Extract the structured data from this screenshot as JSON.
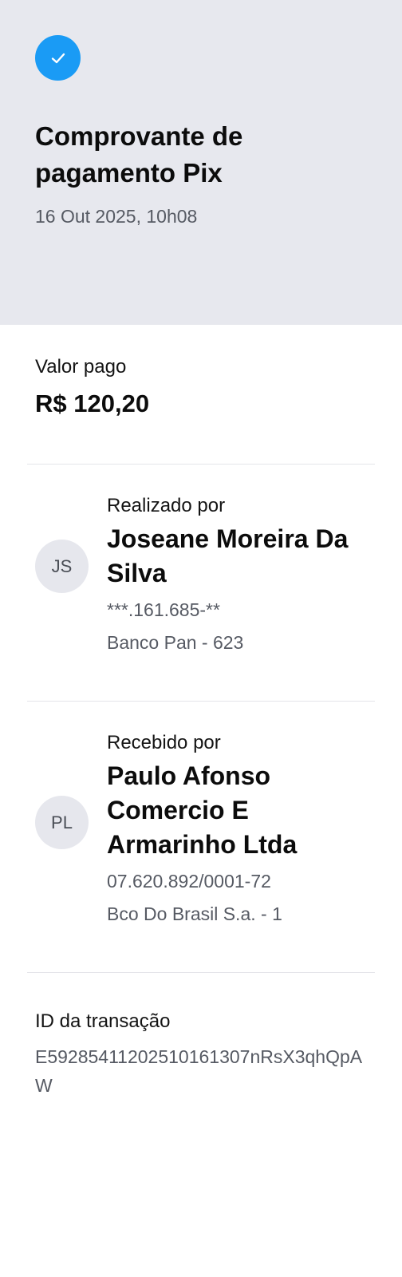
{
  "header": {
    "title": "Comprovante de pagamento Pix",
    "date": "16 Out 2025, 10h08",
    "icon": "check-icon",
    "accent_color": "#1a9bf5"
  },
  "amount": {
    "label": "Valor pago",
    "value": "R$ 120,20"
  },
  "payer": {
    "label": "Realizado por",
    "initials": "JS",
    "name": "Joseane Moreira Da Silva",
    "document": "***.161.685-**",
    "bank": "Banco Pan - 623"
  },
  "receiver": {
    "label": "Recebido por",
    "initials": "PL",
    "name": "Paulo Afonso Comercio E Armarinho Ltda",
    "document": "07.620.892/0001-72",
    "bank": "Bco Do Brasil S.a. - 1"
  },
  "transaction": {
    "label": "ID da transação",
    "id": "E59285411202510161307nRsX3qhQpAW"
  }
}
